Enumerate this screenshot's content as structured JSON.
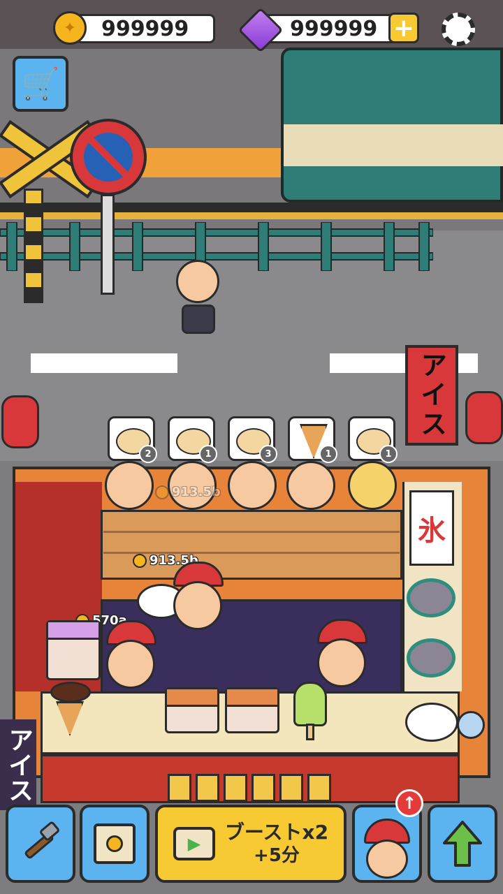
{
  "hud": {
    "coins": "999999",
    "gems": "999999",
    "plus": "+"
  },
  "signs": {
    "banner": "アイス",
    "ice_kanji": "氷",
    "side_sign": "アイス"
  },
  "orders": [
    {
      "item": "crepe-plate",
      "count": "2"
    },
    {
      "item": "crepe-plate",
      "count": "1"
    },
    {
      "item": "crepe-plate",
      "count": "3"
    },
    {
      "item": "chocolate-cone",
      "count": "1"
    },
    {
      "item": "crepe-plate",
      "count": "1"
    }
  ],
  "floating": {
    "earn_a": "913.5b",
    "earn_b": "570a",
    "earn_ghost": "913.5b"
  },
  "bottom": {
    "boost_line1": "ブーストx2",
    "boost_line2": "+5分",
    "staff_badge": "↑"
  },
  "colors": {
    "accent_blue": "#5bb4ef",
    "accent_yellow": "#f7c933",
    "shop_red": "#d9383a"
  }
}
